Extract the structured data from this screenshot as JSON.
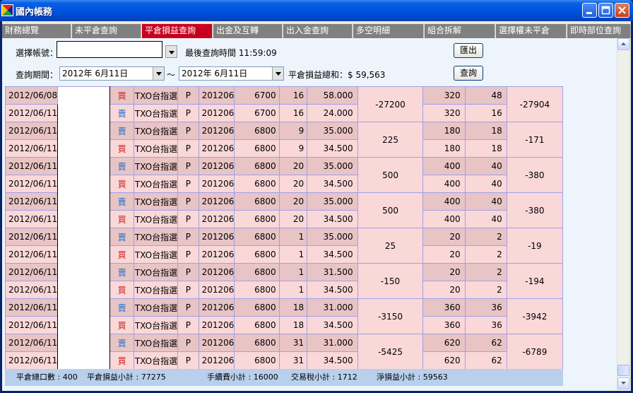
{
  "window": {
    "title": "國內帳務",
    "colors": {
      "title_bar": "#0054e3",
      "active_tab": "#c8001e",
      "inactive_tab": "#808080",
      "row_dark": "#e8c4c4",
      "row_light": "#fad8d8",
      "sell_text": "#1e6fd0",
      "buy_text": "#d01e1e",
      "footer_bg": "#b8d0ec"
    }
  },
  "tabs": [
    {
      "label": "財務總覽",
      "active": false
    },
    {
      "label": "未平倉查詢",
      "active": false
    },
    {
      "label": "平倉損益查詢",
      "active": true
    },
    {
      "label": "出金及互轉",
      "active": false
    },
    {
      "label": "出入金查詢",
      "active": false
    },
    {
      "label": "多空明細",
      "active": false
    },
    {
      "label": "組合拆解",
      "active": false
    },
    {
      "label": "選擇權未平倉",
      "active": false
    },
    {
      "label": "即時部位查詢",
      "active": false
    }
  ],
  "form": {
    "account_label": "選擇帳號：",
    "account_value": "",
    "last_query_label": "最後查詢時間 11:59:09",
    "export_button": "匯出",
    "period_label": "查詢期間：",
    "start_date": "2012年  6月11日",
    "tilde": "～",
    "end_date": "2012年  6月11日",
    "total_pl_label": "平倉損益總和：$ 59,563",
    "query_button": "查詢"
  },
  "groups": [
    {
      "rows": [
        {
          "date": "2012/06/08",
          "side": "買",
          "name": "TXO台指選",
          "cp": "P",
          "month": "201206",
          "strike": "6700",
          "qty": "16",
          "price": "58.000",
          "fee": "320",
          "tax": "48"
        },
        {
          "date": "2012/06/11",
          "side": "賣",
          "name": "TXO台指選",
          "cp": "P",
          "month": "201206",
          "strike": "6700",
          "qty": "16",
          "price": "24.000",
          "fee": "320",
          "tax": "16"
        }
      ],
      "pl": "-27200",
      "net": "-27904"
    },
    {
      "rows": [
        {
          "date": "2012/06/11",
          "side": "賣",
          "name": "TXO台指選",
          "cp": "P",
          "month": "201206",
          "strike": "6800",
          "qty": "9",
          "price": "35.000",
          "fee": "180",
          "tax": "18"
        },
        {
          "date": "2012/06/11",
          "side": "買",
          "name": "TXO台指選",
          "cp": "P",
          "month": "201206",
          "strike": "6800",
          "qty": "9",
          "price": "34.500",
          "fee": "180",
          "tax": "18"
        }
      ],
      "pl": "225",
      "net": "-171"
    },
    {
      "rows": [
        {
          "date": "2012/06/11",
          "side": "賣",
          "name": "TXO台指選",
          "cp": "P",
          "month": "201206",
          "strike": "6800",
          "qty": "20",
          "price": "35.000",
          "fee": "400",
          "tax": "40"
        },
        {
          "date": "2012/06/11",
          "side": "買",
          "name": "TXO台指選",
          "cp": "P",
          "month": "201206",
          "strike": "6800",
          "qty": "20",
          "price": "34.500",
          "fee": "400",
          "tax": "40"
        }
      ],
      "pl": "500",
      "net": "-380"
    },
    {
      "rows": [
        {
          "date": "2012/06/11",
          "side": "賣",
          "name": "TXO台指選",
          "cp": "P",
          "month": "201206",
          "strike": "6800",
          "qty": "20",
          "price": "35.000",
          "fee": "400",
          "tax": "40"
        },
        {
          "date": "2012/06/11",
          "side": "買",
          "name": "TXO台指選",
          "cp": "P",
          "month": "201206",
          "strike": "6800",
          "qty": "20",
          "price": "34.500",
          "fee": "400",
          "tax": "40"
        }
      ],
      "pl": "500",
      "net": "-380"
    },
    {
      "rows": [
        {
          "date": "2012/06/11",
          "side": "賣",
          "name": "TXO台指選",
          "cp": "P",
          "month": "201206",
          "strike": "6800",
          "qty": "1",
          "price": "35.000",
          "fee": "20",
          "tax": "2"
        },
        {
          "date": "2012/06/11",
          "side": "買",
          "name": "TXO台指選",
          "cp": "P",
          "month": "201206",
          "strike": "6800",
          "qty": "1",
          "price": "34.500",
          "fee": "20",
          "tax": "2"
        }
      ],
      "pl": "25",
      "net": "-19"
    },
    {
      "rows": [
        {
          "date": "2012/06/11",
          "side": "賣",
          "name": "TXO台指選",
          "cp": "P",
          "month": "201206",
          "strike": "6800",
          "qty": "1",
          "price": "31.500",
          "fee": "20",
          "tax": "2"
        },
        {
          "date": "2012/06/11",
          "side": "買",
          "name": "TXO台指選",
          "cp": "P",
          "month": "201206",
          "strike": "6800",
          "qty": "1",
          "price": "34.500",
          "fee": "20",
          "tax": "2"
        }
      ],
      "pl": "-150",
      "net": "-194"
    },
    {
      "rows": [
        {
          "date": "2012/06/11",
          "side": "賣",
          "name": "TXO台指選",
          "cp": "P",
          "month": "201206",
          "strike": "6800",
          "qty": "18",
          "price": "31.000",
          "fee": "360",
          "tax": "36"
        },
        {
          "date": "2012/06/11",
          "side": "買",
          "name": "TXO台指選",
          "cp": "P",
          "month": "201206",
          "strike": "6800",
          "qty": "18",
          "price": "34.500",
          "fee": "360",
          "tax": "36"
        }
      ],
      "pl": "-3150",
      "net": "-3942"
    },
    {
      "rows": [
        {
          "date": "2012/06/11",
          "side": "賣",
          "name": "TXO台指選",
          "cp": "P",
          "month": "201206",
          "strike": "6800",
          "qty": "31",
          "price": "31.000",
          "fee": "620",
          "tax": "62"
        },
        {
          "date": "2012/06/11",
          "side": "買",
          "name": "TXO台指選",
          "cp": "P",
          "month": "201206",
          "strike": "6800",
          "qty": "31",
          "price": "34.500",
          "fee": "620",
          "tax": "62"
        }
      ],
      "pl": "-5425",
      "net": "-6789"
    }
  ],
  "footer": {
    "total_lots": "平倉總口數 : 400",
    "pl_subtotal": "平倉損益小計 : 77275",
    "fee_subtotal": "手續費小計 : 16000",
    "tax_subtotal": "交易稅小計 : 1712",
    "net_subtotal": "淨損益小計 : 59563"
  }
}
